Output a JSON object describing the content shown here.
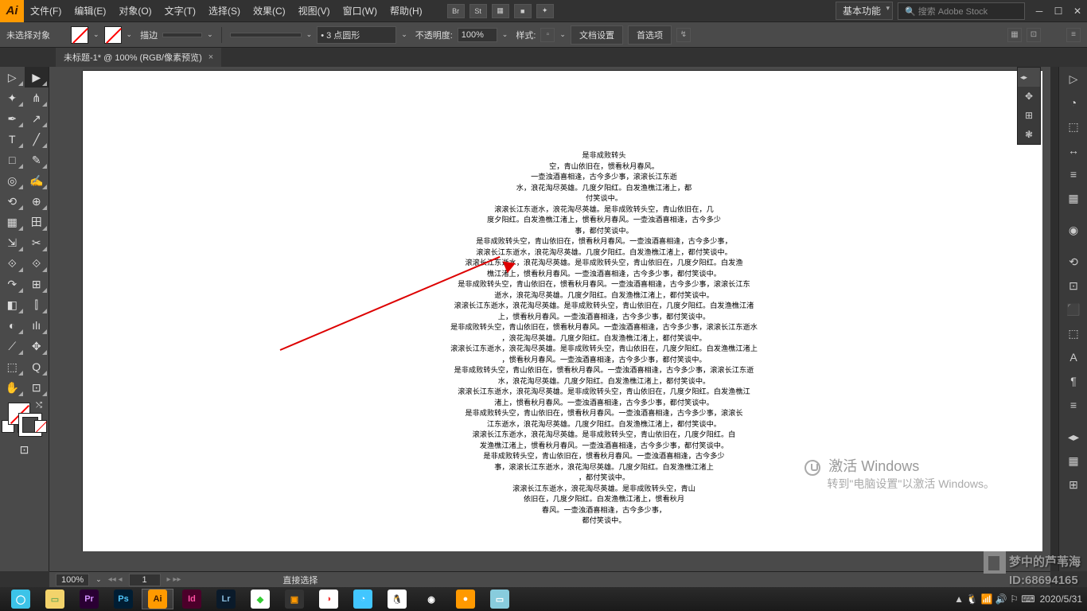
{
  "menu": {
    "logo": "Ai",
    "items": [
      "文件(F)",
      "编辑(E)",
      "对象(O)",
      "文字(T)",
      "选择(S)",
      "效果(C)",
      "视图(V)",
      "窗口(W)",
      "帮助(H)"
    ],
    "appicons": [
      "Br",
      "St",
      "▦",
      "■",
      "✦"
    ],
    "workspace": "基本功能",
    "search_ph": "🔍 搜索 Adobe Stock"
  },
  "control": {
    "no_selection": "未选择对象",
    "stroke_label": "描边",
    "stroke_val": "",
    "points_prefix": "• 3 点圆形",
    "opacity_label": "不透明度:",
    "opacity_val": "100%",
    "style_label": "样式:",
    "doc_setup": "文档设置",
    "prefs": "首选项"
  },
  "doctab": {
    "title": "未标题-1* @ 100% (RGB/像素预览)",
    "close": "×"
  },
  "tools": [
    "▷",
    "▶",
    "✦",
    "⋔",
    "✒",
    "↗",
    "T",
    "╱",
    "□",
    "✎",
    "◎",
    "✍",
    "⟲",
    "⊕",
    "▦",
    "田",
    "⇲",
    "✂",
    "⟐",
    "⟐",
    "↷",
    "⊞",
    "◧",
    "⫿",
    "◐",
    "ılı",
    "⟋",
    "✥",
    "⬚",
    "Q",
    "✋",
    "⊡"
  ],
  "libpanel": [
    "◂▸",
    "✥",
    "⊞",
    "❃"
  ],
  "rightdock": [
    "▷",
    "◔",
    "⬚",
    "↔",
    "≡",
    "▦",
    "",
    "◉",
    "",
    "⟲",
    "⊡",
    "⬛",
    "⬚",
    "A",
    "¶",
    "≡",
    "",
    "◂▸",
    "▦",
    "⊞"
  ],
  "status": {
    "zoom": "100%",
    "nav_prefix": "◂◂ ◂",
    "nav_page": "1",
    "nav_suffix": "▸ ▸▸",
    "tool": "直接选择"
  },
  "watermark": {
    "title": "激活 Windows",
    "sub": "转到\"电脑设置\"以激活 Windows。"
  },
  "wm2": {
    "line1": "梦中的芦苇海",
    "line2": "ID:68694165"
  },
  "taskbar": {
    "apps": [
      {
        "bg": "#3cc3e8",
        "fg": "#fff",
        "label": "◯",
        "active": false
      },
      {
        "bg": "#f3d36b",
        "fg": "#7a5",
        "label": "▭",
        "active": false
      },
      {
        "bg": "#2a0033",
        "fg": "#d490ff",
        "label": "Pr",
        "active": false
      },
      {
        "bg": "#001d33",
        "fg": "#4fc3f7",
        "label": "Ps",
        "active": false
      },
      {
        "bg": "#ff9a00",
        "fg": "#3a1800",
        "label": "Ai",
        "active": true
      },
      {
        "bg": "#4b002a",
        "fg": "#ff4fa3",
        "label": "Id",
        "active": false
      },
      {
        "bg": "#0a1a2a",
        "fg": "#8bd",
        "label": "Lr",
        "active": false
      },
      {
        "bg": "#fff",
        "fg": "#3c3",
        "label": "◆",
        "active": false
      },
      {
        "bg": "#333",
        "fg": "#f90",
        "label": "▣",
        "active": false
      },
      {
        "bg": "#fff",
        "fg": "#e33",
        "label": "◑",
        "active": false
      },
      {
        "bg": "#42c6ff",
        "fg": "#fff",
        "label": "◔",
        "active": false
      },
      {
        "bg": "#fff",
        "fg": "#d33",
        "label": "🐧",
        "active": false
      },
      {
        "bg": "transparent",
        "fg": "#fff",
        "label": "◉",
        "active": false
      },
      {
        "bg": "#f90",
        "fg": "#fff",
        "label": "●",
        "active": false
      },
      {
        "bg": "#8cd",
        "fg": "#fff",
        "label": "▭",
        "active": false
      }
    ],
    "tray": [
      "▲",
      "🐧",
      "📶",
      "🔊",
      "⚐",
      "⌨"
    ],
    "date": "2020/5/31"
  },
  "poem": [
    "是非成败转头",
    "空，青山依旧在，惯看秋月春风。",
    "一壶浊酒喜相逢，古今多少事，滚滚长江东逝",
    "水，浪花淘尽英雄。几度夕阳红。白发渔樵江渚上，都",
    "付笑谈中。",
    "滚滚长江东逝水，浪花淘尽英雄。是非成败转头空，青山依旧在，几",
    "度夕阳红。白发渔樵江渚上，惯看秋月春风。一壶浊酒喜相逢，古今多少",
    "事，都付笑谈中。",
    "是非成败转头空，青山依旧在，惯看秋月春风。一壶浊酒喜相逢，古今多少事，",
    "滚滚长江东逝水，浪花淘尽英雄。几度夕阳红。白发渔樵江渚上，都付笑谈中。",
    "滚滚长江东逝水，浪花淘尽英雄。是非成败转头空，青山依旧在，几度夕阳红。白发渔",
    "樵江渚上，惯看秋月春风。一壶浊酒喜相逢，古今多少事，都付笑谈中。",
    "是非成败转头空，青山依旧在，惯看秋月春风。一壶浊酒喜相逢，古今多少事，滚滚长江东",
    "逝水，浪花淘尽英雄。几度夕阳红。白发渔樵江渚上，都付笑谈中。",
    "滚滚长江东逝水，浪花淘尽英雄。是非成败转头空，青山依旧在，几度夕阳红。白发渔樵江渚",
    "上，惯看秋月春风。一壶浊酒喜相逢，古今多少事，都付笑谈中。",
    "是非成败转头空，青山依旧在，惯看秋月春风。一壶浊酒喜相逢，古今多少事，滚滚长江东逝水",
    "，浪花淘尽英雄。几度夕阳红。白发渔樵江渚上，都付笑谈中。",
    "滚滚长江东逝水，浪花淘尽英雄。是非成败转头空，青山依旧在，几度夕阳红。白发渔樵江渚上",
    "，惯看秋月春风。一壶浊酒喜相逢，古今多少事，都付笑谈中。",
    "是非成败转头空，青山依旧在，惯看秋月春风。一壶浊酒喜相逢，古今多少事，滚滚长江东逝",
    "水，浪花淘尽英雄。几度夕阳红。白发渔樵江渚上，都付笑谈中。",
    "滚滚长江东逝水，浪花淘尽英雄。是非成败转头空，青山依旧在，几度夕阳红。白发渔樵江",
    "渚上，惯看秋月春风。一壶浊酒喜相逢，古今多少事，都付笑谈中。",
    "是非成败转头空，青山依旧在，惯看秋月春风。一壶浊酒喜相逢，古今多少事，滚滚长",
    "江东逝水，浪花淘尽英雄。几度夕阳红。白发渔樵江渚上，都付笑谈中。",
    "滚滚长江东逝水，浪花淘尽英雄。是非成败转头空，青山依旧在，几度夕阳红。白",
    "发渔樵江渚上，惯看秋月春风。一壶浊酒喜相逢，古今多少事，都付笑谈中。",
    "是非成败转头空，青山依旧在，惯看秋月春风。一壶浊酒喜相逢，古今多少",
    "事，滚滚长江东逝水，浪花淘尽英雄。几度夕阳红。白发渔樵江渚上",
    "，都付笑谈中。",
    "滚滚长江东逝水，浪花淘尽英雄。是非成败转头空，青山",
    "依旧在，几度夕阳红。白发渔樵江渚上，惯看秋月",
    "春风。一壶浊酒喜相逢，古今多少事，",
    "都付笑谈中。"
  ]
}
